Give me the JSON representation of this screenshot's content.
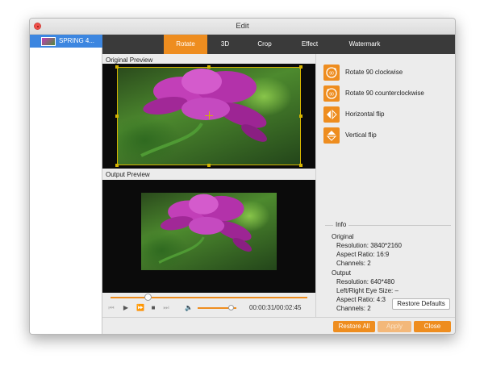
{
  "window": {
    "title": "Edit"
  },
  "sidebar": {
    "items": [
      {
        "label": "SPRING 4..."
      }
    ]
  },
  "tabs": [
    {
      "label": "Rotate",
      "active": true
    },
    {
      "label": "3D",
      "active": false
    },
    {
      "label": "Crop",
      "active": false
    },
    {
      "label": "Effect",
      "active": false
    },
    {
      "label": "Watermark",
      "active": false
    }
  ],
  "preview": {
    "original_label": "Original Preview",
    "output_label": "Output Preview"
  },
  "player": {
    "progress_fraction": 0.19,
    "volume_fraction": 0.85,
    "time": "00:00:31/00:02:45"
  },
  "rotate_actions": [
    {
      "label": "Rotate 90 clockwise",
      "icon": "rotate-clockwise-icon"
    },
    {
      "label": "Rotate 90 counterclockwise",
      "icon": "rotate-counterclockwise-icon"
    },
    {
      "label": "Horizontal flip",
      "icon": "horizontal-flip-icon"
    },
    {
      "label": "Vertical flip",
      "icon": "vertical-flip-icon"
    }
  ],
  "info": {
    "title": "Info",
    "original_heading": "Original",
    "original_resolution": "Resolution: 3840*2160",
    "original_aspect": "Aspect Ratio: 16:9",
    "original_channels": "Channels: 2",
    "output_heading": "Output",
    "output_resolution": "Resolution: 640*480",
    "output_eye_size": "Left/Right Eye Size: –",
    "output_aspect": "Aspect Ratio: 4:3",
    "output_channels": "Channels: 2"
  },
  "buttons": {
    "restore_defaults": "Restore Defaults",
    "restore_all": "Restore All",
    "apply": "Apply",
    "close": "Close"
  },
  "colors": {
    "accent": "#ee8d1f",
    "tabbar": "#3a3a3a",
    "selected_item": "#3c86e0",
    "frame": "#d6b400"
  }
}
